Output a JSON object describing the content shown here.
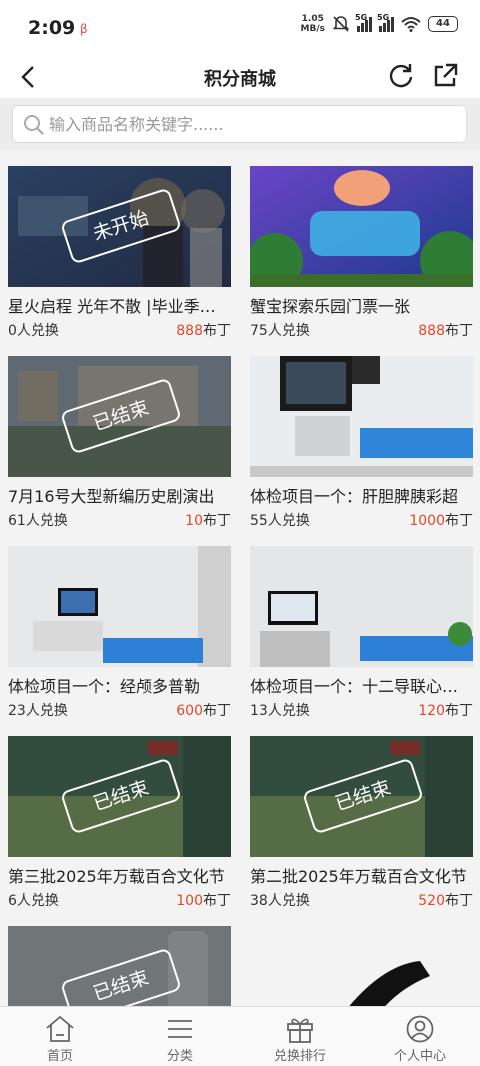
{
  "status": {
    "time": "2:09",
    "app_indicator": "β",
    "net_speed": "1.05",
    "net_unit": "MB/s",
    "sig1": "5G",
    "sig2": "5G",
    "battery": "44"
  },
  "header": {
    "title": "积分商城"
  },
  "search": {
    "placeholder": "输入商品名称关键字......"
  },
  "products": [
    {
      "name": "星火启程 光年不散 |毕业季晚会",
      "redeemed": "0人兑换",
      "points": "888",
      "unit": "布丁",
      "status": "未开始"
    },
    {
      "name": "蟹宝探索乐园门票一张",
      "redeemed": "75人兑换",
      "points": "888",
      "unit": "布丁",
      "status": ""
    },
    {
      "name": "7月16号大型新编历史剧演出",
      "redeemed": "61人兑换",
      "points": "10",
      "unit": "布丁",
      "status": "已结束"
    },
    {
      "name": "体检项目一个：肝胆脾胰彩超",
      "redeemed": "55人兑换",
      "points": "1000",
      "unit": "布丁",
      "status": ""
    },
    {
      "name": "体检项目一个：经颅多普勒",
      "redeemed": "23人兑换",
      "points": "600",
      "unit": "布丁",
      "status": ""
    },
    {
      "name": "体检项目一个：十二导联心电图",
      "redeemed": "13人兑换",
      "points": "120",
      "unit": "布丁",
      "status": ""
    },
    {
      "name": "第三批2025年万载百合文化节",
      "redeemed": "6人兑换",
      "points": "100",
      "unit": "布丁",
      "status": "已结束"
    },
    {
      "name": "第二批2025年万载百合文化节",
      "redeemed": "38人兑换",
      "points": "520",
      "unit": "布丁",
      "status": "已结束"
    },
    {
      "status": "已结束"
    },
    {
      "status": ""
    }
  ],
  "nav": [
    {
      "label": "首页",
      "icon": "home-icon"
    },
    {
      "label": "分类",
      "icon": "menu-icon"
    },
    {
      "label": "兑换排行",
      "icon": "gift-icon"
    },
    {
      "label": "个人中心",
      "icon": "user-icon"
    }
  ],
  "colors": {
    "accent": "#e4472a"
  }
}
